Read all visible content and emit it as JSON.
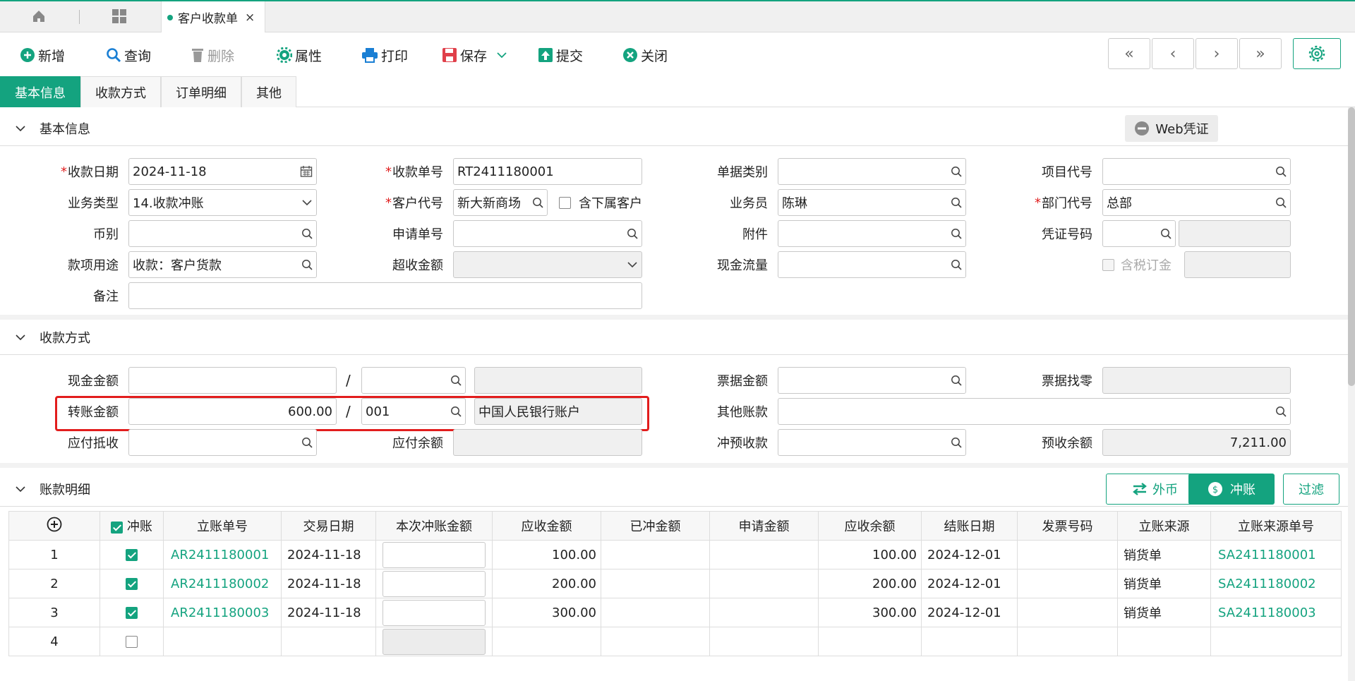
{
  "tab": {
    "title": "客户收款单",
    "close": "×"
  },
  "toolbar": {
    "add": "新增",
    "query": "查询",
    "delete": "删除",
    "properties": "属性",
    "print": "打印",
    "save": "保存",
    "submit": "提交",
    "close": "关闭"
  },
  "subtabs": [
    "基本信息",
    "收款方式",
    "订单明细",
    "其他"
  ],
  "basic": {
    "title": "基本信息",
    "web_voucher": "Web凭证",
    "receipt_date_label": "收款日期",
    "receipt_date": "2024-11-18",
    "receipt_no_label": "收款单号",
    "receipt_no": "RT2411180001",
    "doc_type_label": "单据类别",
    "doc_type": "",
    "project_code_label": "项目代号",
    "project_code": "",
    "biz_type_label": "业务类型",
    "biz_type": "14.收款冲账",
    "customer_label": "客户代号",
    "customer": "新大新商场",
    "include_sub_label": "含下属客户",
    "salesman_label": "业务员",
    "salesman": "陈琳",
    "dept_label": "部门代号",
    "dept": "总部",
    "currency_label": "币别",
    "currency": "",
    "apply_no_label": "申请单号",
    "apply_no": "",
    "attachment_label": "附件",
    "attachment": "",
    "voucher_no_label": "凭证号码",
    "voucher_no": "",
    "purpose_label": "款项用途",
    "purpose": "收款：客户货款",
    "over_amount_label": "超收金额",
    "over_amount": "",
    "cash_flow_label": "现金流量",
    "cash_flow": "",
    "tax_deposit_label": "含税订金",
    "remark_label": "备注",
    "remark": ""
  },
  "payment": {
    "title": "收款方式",
    "cash_label": "现金金额",
    "cash": "",
    "cash_code": "",
    "cash_account": "",
    "transfer_label": "转账金额",
    "transfer": "600.00",
    "transfer_code": "001",
    "transfer_account": "中国人民银行账户",
    "offset_label": "应付抵收",
    "offset": "",
    "payable_balance_label": "应付余额",
    "payable_balance": "",
    "bill_label": "票据金额",
    "bill": "",
    "bill_change_label": "票据找零",
    "bill_change": "",
    "other_label": "其他账款",
    "other": "",
    "prepay_offset_label": "冲预收款",
    "prepay_offset": "",
    "prepay_balance_label": "预收余额",
    "prepay_balance": "7,211.00",
    "separator": "/"
  },
  "details": {
    "title": "账款明细",
    "btn_foreign": "外币",
    "btn_offset": "冲账",
    "btn_filter": "过滤",
    "columns": [
      "",
      "冲账",
      "立账单号",
      "交易日期",
      "本次冲账金额",
      "应收金额",
      "已冲金额",
      "申请金额",
      "应收余额",
      "结账日期",
      "发票号码",
      "立账来源",
      "立账来源单号"
    ],
    "rows": [
      {
        "no": "1",
        "checked": true,
        "ar_no": "AR2411180001",
        "date": "2024-11-18",
        "amount": "100.00",
        "balance": "100.00",
        "close_date": "2024-12-01",
        "source": "销货单",
        "source_no": "SA2411180001"
      },
      {
        "no": "2",
        "checked": true,
        "ar_no": "AR2411180002",
        "date": "2024-11-18",
        "amount": "200.00",
        "balance": "200.00",
        "close_date": "2024-12-01",
        "source": "销货单",
        "source_no": "SA2411180002"
      },
      {
        "no": "3",
        "checked": true,
        "ar_no": "AR2411180003",
        "date": "2024-11-18",
        "amount": "300.00",
        "balance": "300.00",
        "close_date": "2024-12-01",
        "source": "销货单",
        "source_no": "SA2411180003"
      },
      {
        "no": "4",
        "checked": false,
        "ar_no": "",
        "date": "",
        "amount": "",
        "balance": "",
        "close_date": "",
        "source": "",
        "source_no": ""
      }
    ]
  },
  "colors": {
    "accent": "#14a37f",
    "required": "#e02020",
    "highlight": "#e21d1d"
  }
}
